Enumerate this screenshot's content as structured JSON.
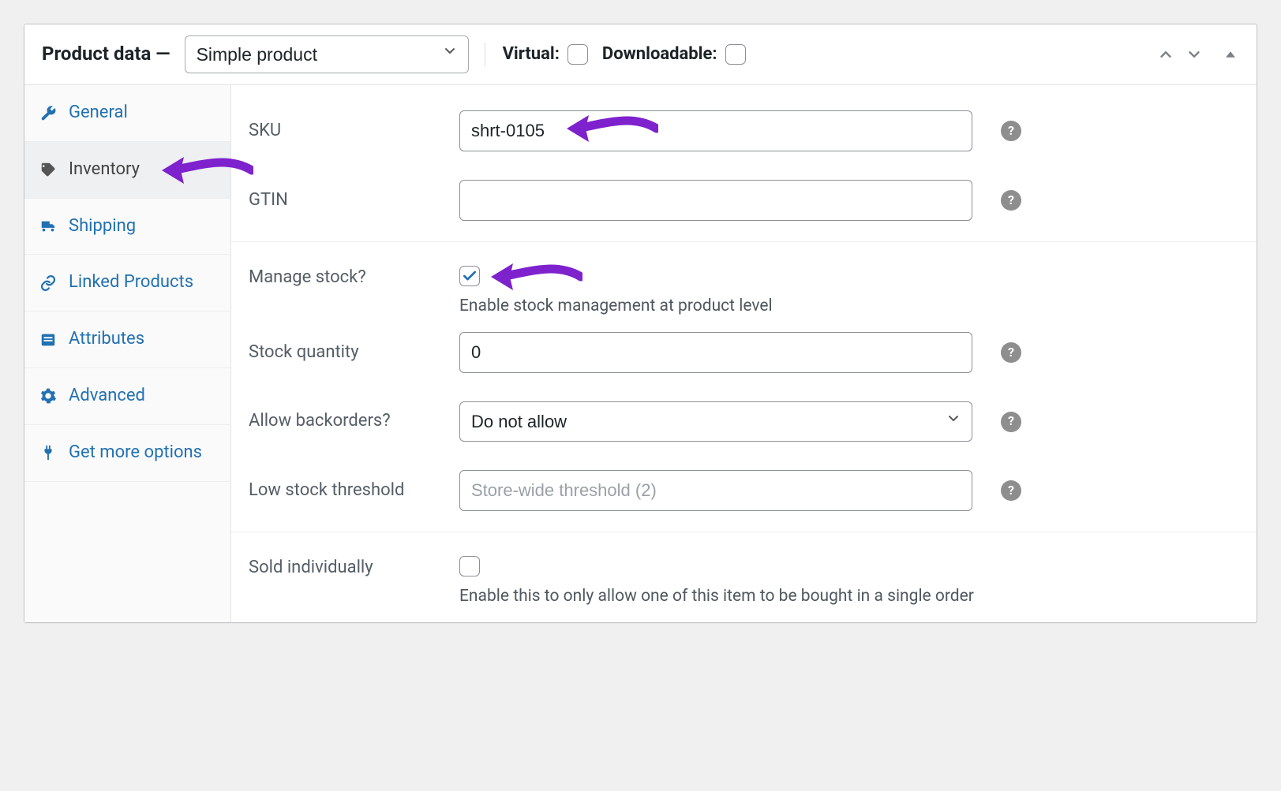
{
  "header": {
    "title": "Product data —",
    "type_options": [
      "Simple product"
    ],
    "type_selected": "Simple product",
    "virtual_label": "Virtual:",
    "downloadable_label": "Downloadable:"
  },
  "sidebar": {
    "items": [
      {
        "key": "general",
        "label": "General"
      },
      {
        "key": "inventory",
        "label": "Inventory"
      },
      {
        "key": "shipping",
        "label": "Shipping"
      },
      {
        "key": "linked",
        "label": "Linked Products"
      },
      {
        "key": "attributes",
        "label": "Attributes"
      },
      {
        "key": "advanced",
        "label": "Advanced"
      },
      {
        "key": "getmore",
        "label": "Get more options"
      }
    ],
    "active": "inventory"
  },
  "fields": {
    "sku": {
      "label": "SKU",
      "value": "shrt-0105"
    },
    "gtin": {
      "label": "GTIN",
      "value": ""
    },
    "manage_stock": {
      "label": "Manage stock?",
      "checked": true,
      "desc": "Enable stock management at product level"
    },
    "stock_qty": {
      "label": "Stock quantity",
      "value": "0"
    },
    "backorders": {
      "label": "Allow backorders?",
      "selected": "Do not allow"
    },
    "low_stock": {
      "label": "Low stock threshold",
      "placeholder": "Store-wide threshold (2)",
      "value": ""
    },
    "sold_individually": {
      "label": "Sold individually",
      "checked": false,
      "desc": "Enable this to only allow one of this item to be bought in a single order"
    }
  },
  "annotations": {
    "arrow_color": "#7e22ce"
  }
}
